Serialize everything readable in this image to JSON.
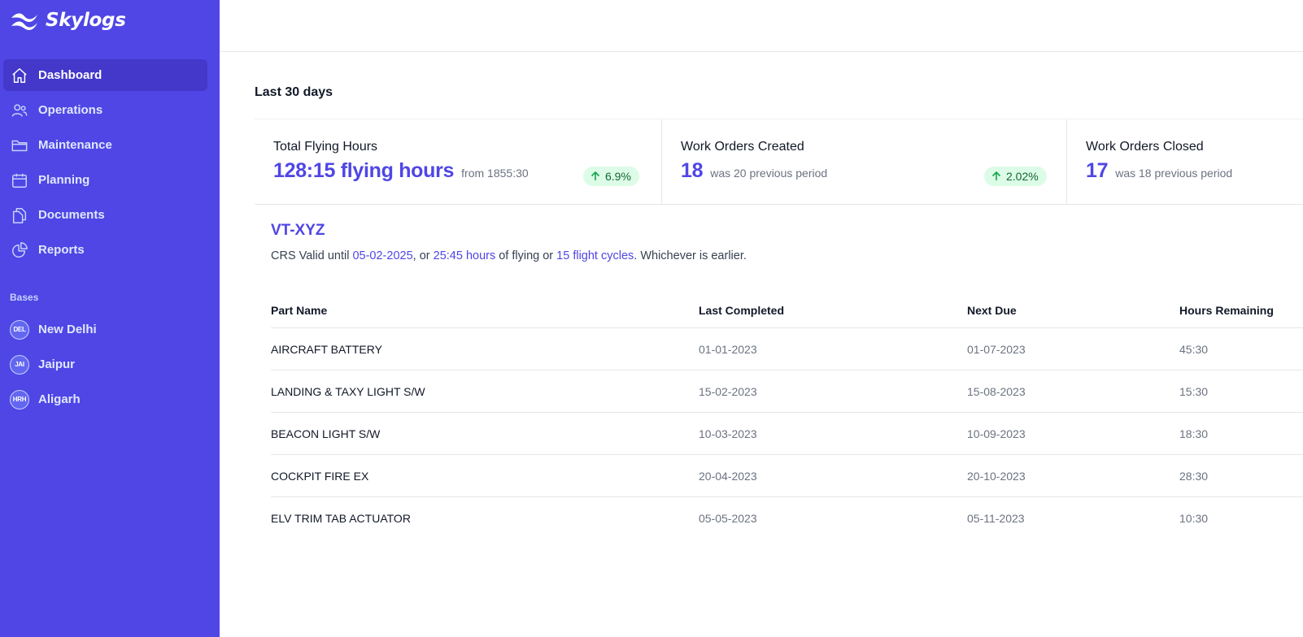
{
  "brand": {
    "name": "Skylogs",
    "logo_icon": "skylogs-wave-icon"
  },
  "sidebar": {
    "nav": [
      {
        "label": "Dashboard",
        "icon": "home-icon",
        "active": true
      },
      {
        "label": "Operations",
        "icon": "users-icon",
        "active": false
      },
      {
        "label": "Maintenance",
        "icon": "folder-icon",
        "active": false
      },
      {
        "label": "Planning",
        "icon": "calendar-icon",
        "active": false
      },
      {
        "label": "Documents",
        "icon": "documents-icon",
        "active": false
      },
      {
        "label": "Reports",
        "icon": "chart-pie-icon",
        "active": false
      }
    ],
    "bases_title": "Bases",
    "bases": [
      {
        "code": "DEL",
        "label": "New Delhi"
      },
      {
        "code": "JAI",
        "label": "Jaipur"
      },
      {
        "code": "HRH",
        "label": "Aligarh"
      }
    ]
  },
  "main": {
    "period_title": "Last 30 days",
    "stats": [
      {
        "label": "Total Flying Hours",
        "value": "128:15 flying hours",
        "sub": "from 1855:30",
        "change": "6.9%",
        "trend": "up"
      },
      {
        "label": "Work Orders Created",
        "value": "18",
        "sub": "was 20 previous period",
        "change": "2.02%",
        "trend": "up"
      },
      {
        "label": "Work Orders Closed",
        "value": "17",
        "sub": "was 18 previous period"
      }
    ],
    "aircraft": {
      "registration": "VT-XYZ",
      "crs_prefix": "CRS Valid until ",
      "crs_date": "05-02-2025",
      "crs_mid1": ", or ",
      "crs_hours": "25:45 hours",
      "crs_mid2": " of flying or ",
      "crs_cycles": "15 flight cycles",
      "crs_suffix": ". Whichever is earlier."
    },
    "table": {
      "columns": [
        "Part Name",
        "Last Completed",
        "Next Due",
        "Hours Remaining"
      ],
      "rows": [
        [
          "AIRCRAFT BATTERY",
          "01-01-2023",
          "01-07-2023",
          "45:30"
        ],
        [
          "LANDING & TAXY LIGHT S/W",
          "15-02-2023",
          "15-08-2023",
          "15:30"
        ],
        [
          "BEACON LIGHT S/W",
          "10-03-2023",
          "10-09-2023",
          "18:30"
        ],
        [
          "COCKPIT FIRE EX",
          "20-04-2023",
          "20-10-2023",
          "28:30"
        ],
        [
          "ELV TRIM TAB ACTUATOR",
          "05-05-2023",
          "05-11-2023",
          "10:30"
        ]
      ]
    }
  },
  "colors": {
    "sidebar_bg": "#4f46e5",
    "sidebar_active": "#4338ca",
    "accent": "#4f46e5",
    "badge_bg": "#dcfce7",
    "badge_text": "#166534"
  }
}
